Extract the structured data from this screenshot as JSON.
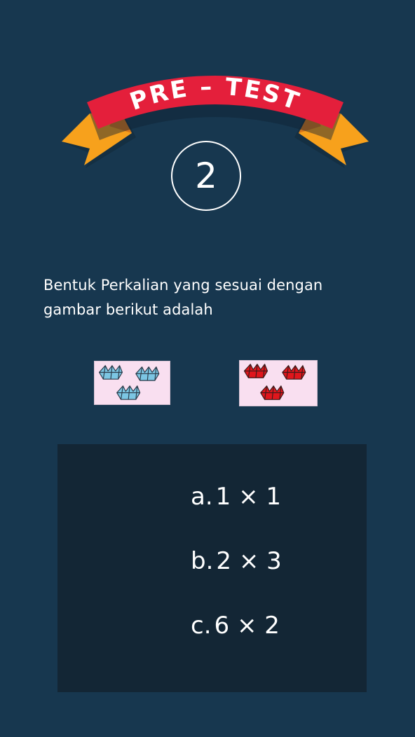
{
  "banner": {
    "title": "PRE – TEST",
    "ribbon_color": "#e41f3b",
    "tail_color": "#f7a11c"
  },
  "question_number": "2",
  "question_text": "Bentuk Perkalian yang sesuai dengan gambar berikut adalah",
  "images": {
    "group_1": {
      "item": "paper-boat-icon",
      "color": "#7cc6e3",
      "count": 3
    },
    "group_2": {
      "item": "paper-boat-icon",
      "color": "#e0161c",
      "count": 3
    }
  },
  "answers": [
    {
      "letter": "a.",
      "expression": "1 × 1"
    },
    {
      "letter": "b.",
      "expression": "2 × 3"
    },
    {
      "letter": "c.",
      "expression": "6 × 2"
    }
  ],
  "colors": {
    "background": "#17374f",
    "answer_panel": "#132635",
    "card": "#f9dff0"
  }
}
